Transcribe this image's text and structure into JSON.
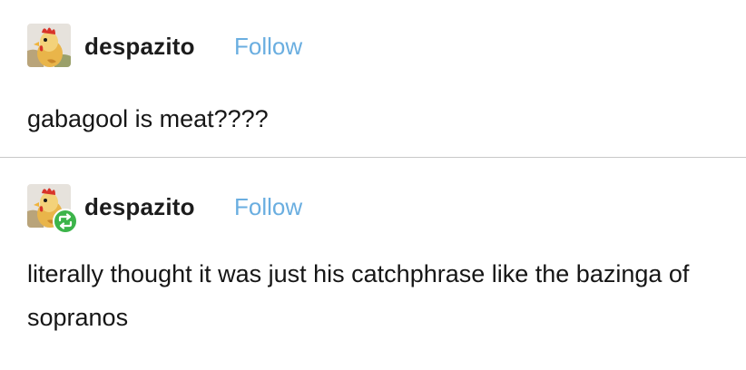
{
  "posts": [
    {
      "username": "despazito",
      "follow_label": "Follow",
      "avatar_icon": "rooster-avatar-icon",
      "reblogged": false,
      "text": "gabagool is meat????"
    },
    {
      "username": "despazito",
      "follow_label": "Follow",
      "avatar_icon": "rooster-avatar-icon",
      "badge_icon": "reblog-icon",
      "reblogged": true,
      "text": "literally thought it was just his catchphrase like the bazinga of sopranos"
    }
  ],
  "colors": {
    "follow": "#6aaee0",
    "reblog_badge": "#3cb44a",
    "divider": "#c8c8c8"
  }
}
